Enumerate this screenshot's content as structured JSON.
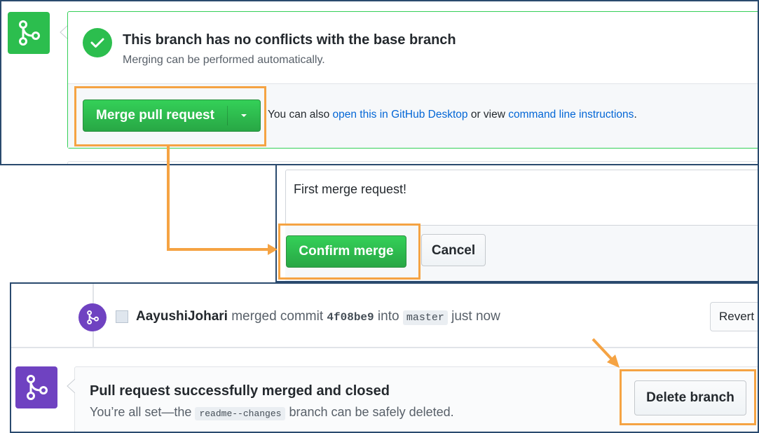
{
  "mergeability": {
    "title": "This branch has no conflicts with the base branch",
    "subtitle": "Merging can be performed automatically.",
    "merge_button_label": "Merge pull request",
    "also_prefix": "You can also ",
    "desktop_link": "open this in GitHub Desktop",
    "or_text": " or view ",
    "cli_link": "command line instructions",
    "period": "."
  },
  "confirm": {
    "message": "First merge request!",
    "confirm_label": "Confirm merge",
    "cancel_label": "Cancel"
  },
  "event": {
    "user": "AayushiJohari",
    "merged_text": " merged commit ",
    "sha": "4f08be9",
    "into_text": " into ",
    "branch": "master",
    "time": " just now",
    "revert_label": "Revert"
  },
  "merged": {
    "title": "Pull request successfully merged and closed",
    "sub_prefix": "You’re all set—the ",
    "branch": "readme--changes",
    "sub_suffix": " branch can be safely deleted.",
    "delete_label": "Delete branch"
  },
  "colors": {
    "green": "#2cbe4e",
    "purple": "#6f42c1",
    "highlight": "#f5a343",
    "link": "#0366d6"
  },
  "icons": [
    "git-merge-icon",
    "check-icon",
    "triangle-down-icon"
  ]
}
